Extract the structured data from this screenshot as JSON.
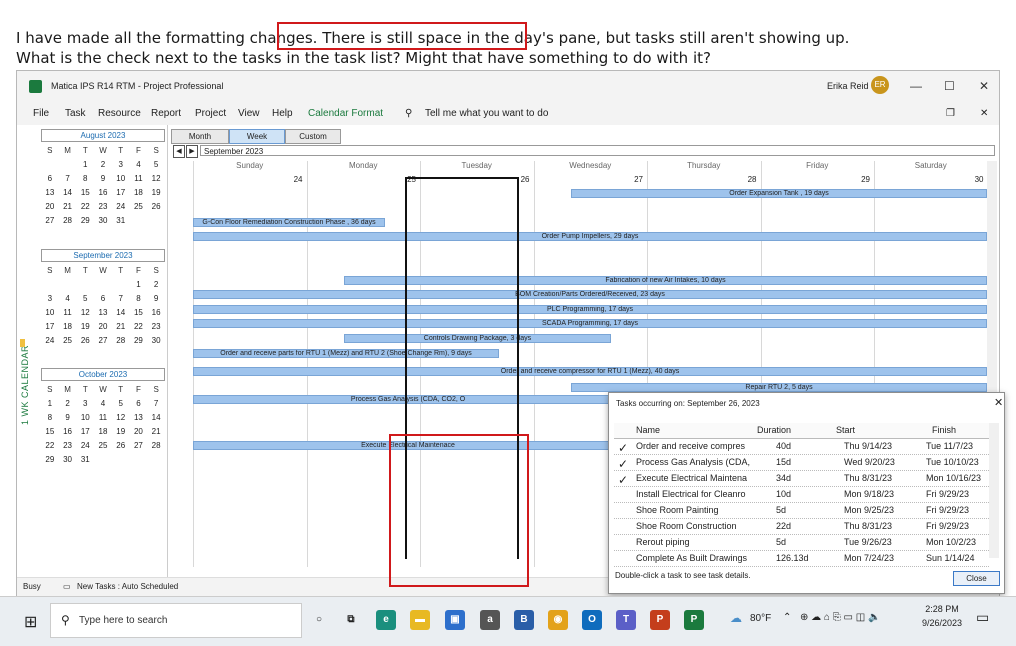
{
  "forum": {
    "line1_a": "I have made all the formatting changes.",
    "line1_b": "There is still space in the day's pane,",
    "line1_c": "but tasks still aren't showing up.",
    "line2": "What is the check next to the tasks in the task list? Might that have something to do with it?"
  },
  "window": {
    "title": "Matica IPS R14 RTM  -  Project Professional",
    "user_name": "Erika Reid",
    "user_initials": "ER",
    "accent_color": "#1b7a3e"
  },
  "menu": [
    "File",
    "Task",
    "Resource",
    "Report",
    "Project",
    "View",
    "Help",
    "Calendar Format"
  ],
  "tell_me": "Tell me what you want to do",
  "side_label": "1 WK CALENDAR",
  "months": [
    {
      "title": "August 2023",
      "days": [
        "",
        "",
        "1",
        "2",
        "3",
        "4",
        "5",
        "6",
        "7",
        "8",
        "9",
        "10",
        "11",
        "12",
        "13",
        "14",
        "15",
        "16",
        "17",
        "18",
        "19",
        "20",
        "21",
        "22",
        "23",
        "24",
        "25",
        "26",
        "27",
        "28",
        "29",
        "30",
        "31",
        "",
        ""
      ]
    },
    {
      "title": "September 2023",
      "days": [
        "",
        "",
        "",
        "",
        "",
        "1",
        "2",
        "3",
        "4",
        "5",
        "6",
        "7",
        "8",
        "9",
        "10",
        "11",
        "12",
        "13",
        "14",
        "15",
        "16",
        "17",
        "18",
        "19",
        "20",
        "21",
        "22",
        "23",
        "24",
        "25",
        "26",
        "27",
        "28",
        "29",
        "30"
      ]
    },
    {
      "title": "October 2023",
      "days": [
        "1",
        "2",
        "3",
        "4",
        "5",
        "6",
        "7",
        "8",
        "9",
        "10",
        "11",
        "12",
        "13",
        "14",
        "15",
        "16",
        "17",
        "18",
        "19",
        "20",
        "21",
        "22",
        "23",
        "24",
        "25",
        "26",
        "27",
        "28",
        "29",
        "30",
        "31",
        "",
        "",
        "",
        ""
      ]
    }
  ],
  "weekday_headers": [
    "S",
    "M",
    "T",
    "W",
    "T",
    "F",
    "S"
  ],
  "view_tabs": [
    "Month",
    "Week",
    "Custom"
  ],
  "current_month": "September 2023",
  "day_names": [
    "Sunday",
    "Monday",
    "Tuesday",
    "Wednesday",
    "Thursday",
    "Friday",
    "Saturday"
  ],
  "day_numbers": [
    "24",
    "25",
    "26",
    "27",
    "28",
    "29",
    "30"
  ],
  "bars": [
    "Order Expansion Tank , 19 days",
    "G-Con Floor Remediation Construction Phase , 36 days",
    "Order Pump Impellers, 29 days",
    "Fabrication of new Air Intakes, 10 days",
    "BOM Creation/Parts Ordered/Received, 23 days",
    "PLC Programming, 17 days",
    "SCADA Programming, 17 days",
    "Controls Drawing Package, 3 days",
    "Order and receive parts for RTU 1 (Mezz) and RTU 2 (Shoe Change Rm), 9 days",
    "Order and receive compressor for RTU 1 (Mezz), 40 days",
    "Repair RTU 2, 5 days",
    "Process Gas Analysis (CDA, CO2, O",
    "Execute Electrical Maintenace"
  ],
  "status": {
    "left": "Busy",
    "mode": "New Tasks : Auto Scheduled"
  },
  "dialog": {
    "title": "Tasks occurring on: September 26, 2023",
    "col_name": "Name",
    "col_duration": "Duration",
    "col_start": "Start",
    "col_finish": "Finish",
    "rows": [
      {
        "check": "✓",
        "name": "Order and receive compres",
        "duration": "40d",
        "start": "Thu 9/14/23",
        "finish": "Tue 11/7/23"
      },
      {
        "check": "✓",
        "name": "Process Gas Analysis (CDA,",
        "duration": "15d",
        "start": "Wed 9/20/23",
        "finish": "Tue 10/10/23"
      },
      {
        "check": "✓",
        "name": "Execute Electrical Maintena",
        "duration": "34d",
        "start": "Thu 8/31/23",
        "finish": "Mon 10/16/23"
      },
      {
        "check": "",
        "name": "Install Electrical for Cleanro",
        "duration": "10d",
        "start": "Mon 9/18/23",
        "finish": "Fri 9/29/23"
      },
      {
        "check": "",
        "name": "Shoe Room Painting",
        "duration": "5d",
        "start": "Mon 9/25/23",
        "finish": "Fri 9/29/23"
      },
      {
        "check": "",
        "name": "Shoe Room Construction",
        "duration": "22d",
        "start": "Thu 8/31/23",
        "finish": "Fri 9/29/23"
      },
      {
        "check": "",
        "name": "Rerout piping",
        "duration": "5d",
        "start": "Tue 9/26/23",
        "finish": "Mon 10/2/23"
      },
      {
        "check": "",
        "name": "Complete As Built Drawings",
        "duration": "126.13d",
        "start": "Mon 7/24/23",
        "finish": "Sun 1/14/24"
      }
    ],
    "footer": "Double-click a task to see task details.",
    "close_label": "Close"
  },
  "taskbar": {
    "search_placeholder": "Type here to search",
    "weather": "80°F",
    "time": "2:28 PM",
    "date": "9/26/2023"
  }
}
